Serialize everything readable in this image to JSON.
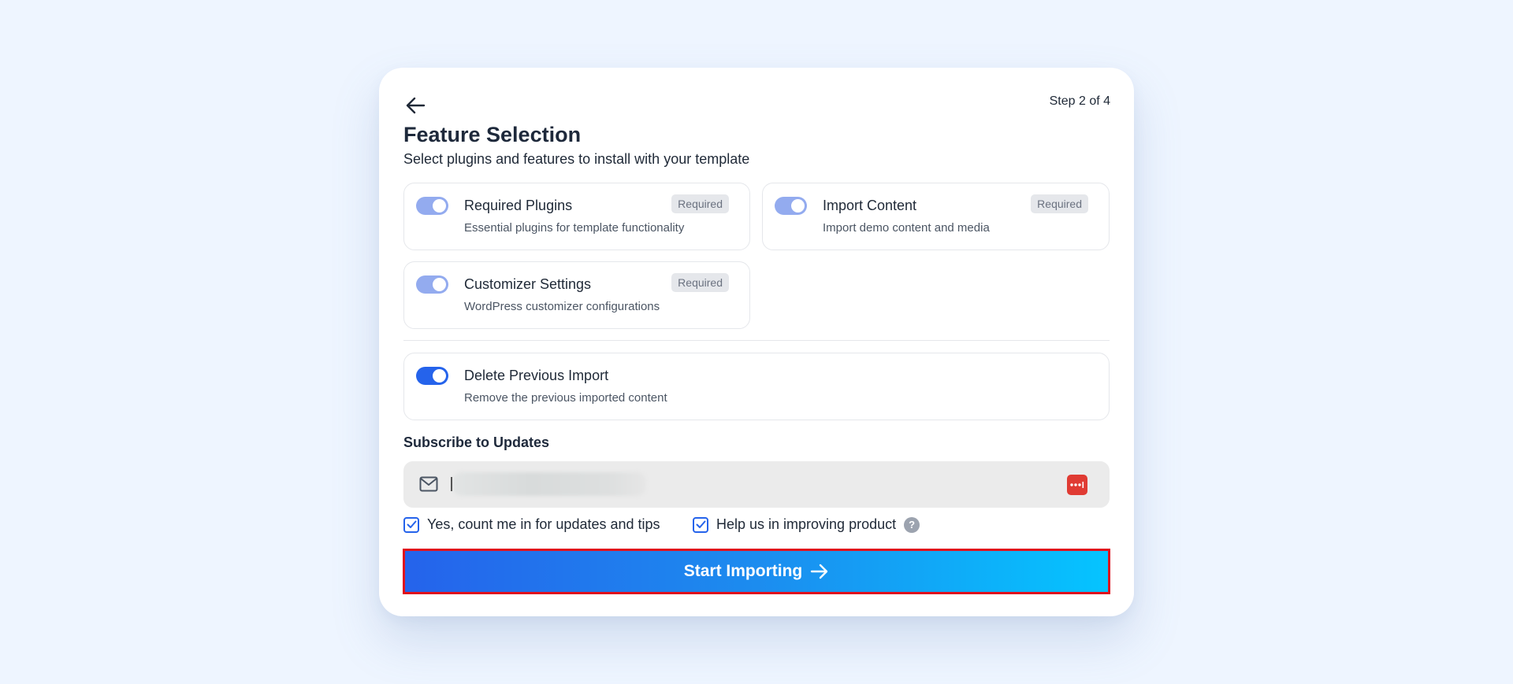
{
  "header": {
    "step": "Step 2 of 4",
    "title": "Feature Selection",
    "subtitle": "Select plugins and features to install with your template"
  },
  "features": [
    {
      "name": "Required Plugins",
      "description": "Essential plugins for template functionality",
      "badge": "Required",
      "enabled": true,
      "locked": true
    },
    {
      "name": "Import Content",
      "description": "Import demo content and media",
      "badge": "Required",
      "enabled": true,
      "locked": true
    },
    {
      "name": "Customizer Settings",
      "description": "WordPress customizer configurations",
      "badge": "Required",
      "enabled": true,
      "locked": true
    }
  ],
  "delete_previous": {
    "name": "Delete Previous Import",
    "description": "Remove the previous imported content",
    "enabled": true
  },
  "subscribe": {
    "label": "Subscribe to Updates",
    "email_value": "",
    "email_placeholder": ""
  },
  "consents": [
    {
      "label": "Yes, count me in for updates and tips",
      "checked": true
    },
    {
      "label": "Help us in improving product",
      "checked": true,
      "help": "?"
    }
  ],
  "cta": {
    "label": "Start Importing"
  },
  "colors": {
    "accent": "#2563eb",
    "toggle_disabled": "#93abef",
    "cta_gradient_start": "#2563eb",
    "cta_gradient_end": "#05c4ff",
    "highlight_border": "#e0101d",
    "page_bg": "#eef5ff"
  },
  "icons": {
    "back": "arrow-left-icon",
    "email": "mail-icon",
    "password_manager": "password-manager-icon",
    "help": "question-circle-icon",
    "cta_arrow": "arrow-right-icon"
  }
}
